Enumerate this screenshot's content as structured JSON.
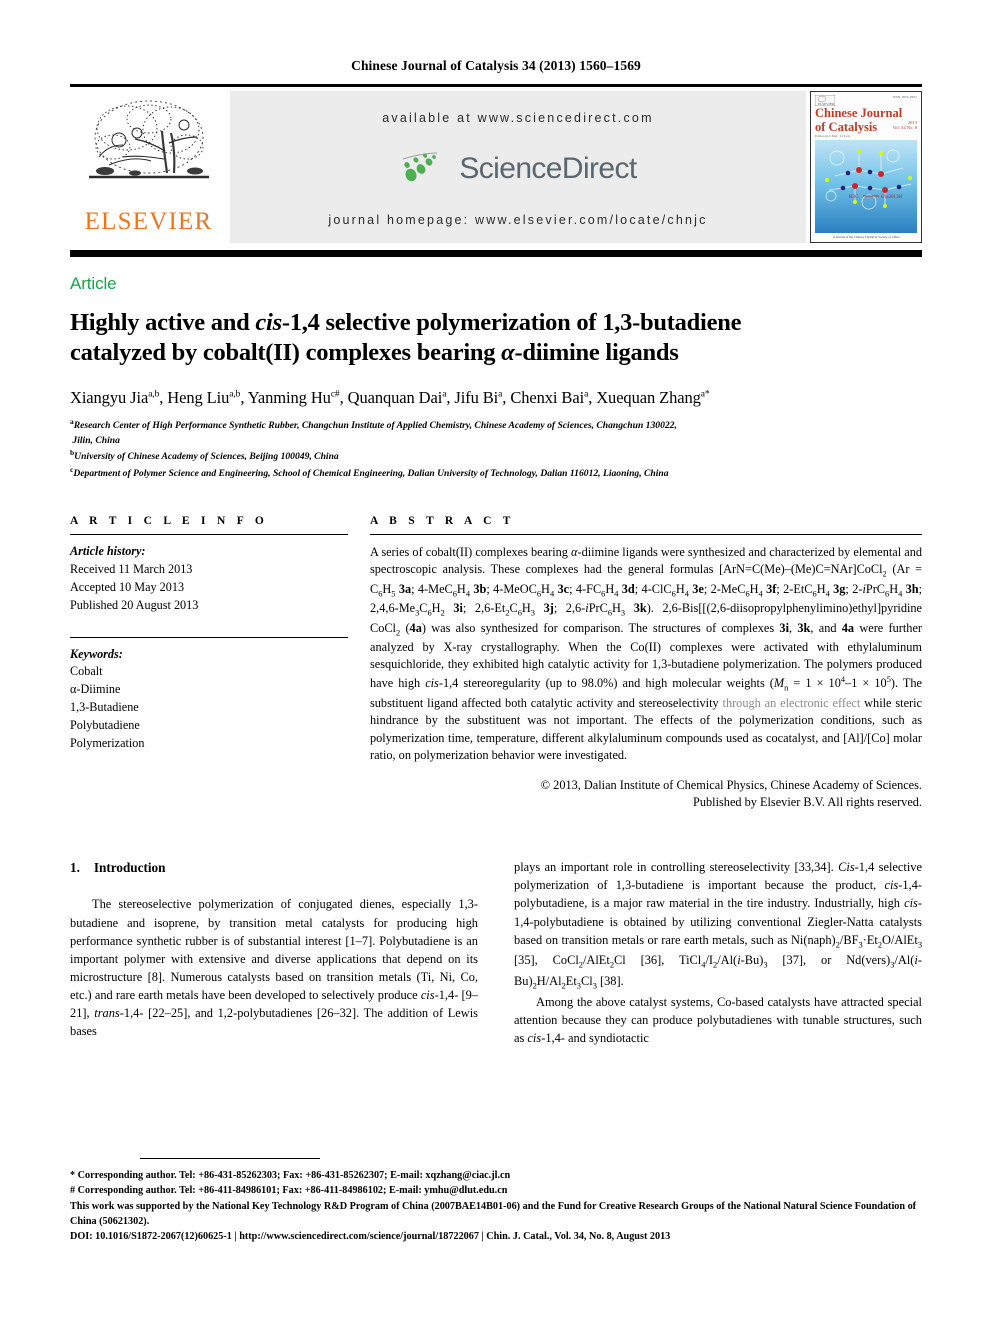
{
  "running_head": "Chinese Journal of Catalysis 34 (2013) 1560–1569",
  "masthead": {
    "publisher_name": "ELSEVIER",
    "available_at": "available at www.sciencedirect.com",
    "sciencedirect_logo_text": "ScienceDirect",
    "journal_homepage": "journal homepage: www.elsevier.com/locate/chnjc",
    "cover": {
      "title_line1": "Chinese Journal",
      "title_line2": "of Catalysis",
      "issn": "ISSN 1872-2067",
      "editor_line": "Editor-in-Chief: Li Can",
      "year": "2013",
      "volume": "Vol. 34  No. 8",
      "footer": "A Journal of the Chinese Chemical Society of China"
    }
  },
  "article_type": "Article",
  "title": {
    "line1_pre": "Highly active and ",
    "line1_italic": "cis",
    "line1_post": "-1,4 selective polymerization of 1,3-butadiene",
    "line2_pre": "catalyzed by cobalt(II) complexes bearing ",
    "line2_italic": "α",
    "line2_post": "-diimine ligands"
  },
  "authors": "Xiangyu Jia a,b, Heng Liu a,b, Yanming Hu c#, Quanquan Dai a, Jifu Bi a, Chenxi Bai a, Xuequan Zhang a*",
  "affiliations": [
    "a Research Center of High Performance Synthetic Rubber, Changchun Institute of Applied Chemistry, Chinese Academy of Sciences, Changchun 130022, Jilin, China",
    "b University of Chinese Academy of Sciences, Beijing 100049, China",
    "c Department of Polymer Science and Engineering, School of Chemical Engineering, Dalian University of Technology, Dalian 116012, Liaoning, China"
  ],
  "affiliation_parts": [
    {
      "mark": "a",
      "text": "Research Center of High Performance Synthetic Rubber, Changchun Institute of Applied Chemistry, Chinese Academy of Sciences, Changchun 130022,"
    },
    {
      "mark": "",
      "text": "Jilin, China"
    },
    {
      "mark": "b",
      "text": "University of Chinese Academy of Sciences, Beijing 100049, China"
    },
    {
      "mark": "c",
      "text": "Department of Polymer Science and Engineering, School of Chemical Engineering, Dalian University of Technology, Dalian 116012, Liaoning, China"
    }
  ],
  "article_info": {
    "heading": "A R T I C L E    I N F O",
    "history_label": "Article history:",
    "received": "Received 11 March 2013",
    "accepted": "Accepted 10 May 2013",
    "published": "Published 20 August 2013",
    "keywords_label": "Keywords:",
    "keywords": [
      "Cobalt",
      "α-Diimine",
      "1,3-Butadiene",
      "Polybutadiene",
      "Polymerization"
    ]
  },
  "abstract": {
    "heading": "A B S T R A C T",
    "p1_a": "A series of cobalt(II) complexes bearing ",
    "p1_alpha": "α",
    "p1_b": "-diimine ligands were synthesized and characterized by elemental and spectroscopic analysis. These complexes had the general formulas [ArN=C(Me)–(Me)C=NAr]CoCl",
    "p1_sub2": "2",
    "p1_c": " (Ar = C",
    "formula_run": "(Ar = C6H5 3a; 4-MeC6H4 3b; 4-MeOC6H4 3c; 4-FC6H4 3d; 4-ClC6H4 3e; 2-MeC6H4 3f; 2-EtC6H4 3g; 2-PrC6H4 3h; 2,4,6-Me3C6H2 3i; 2,6-Et2C6H3 3j; 2,6-iPrC6H3 3k).",
    "p2": "2,6-Bis[[(2,6-diisopropylphenylimino)ethyl]pyridine CoCl2 (4a) was also synthesized for comparison. The structures of complexes 3i, 3k, and 4a were further analyzed by X-ray crystallography. When the Co(II) complexes were activated with ethylaluminum sesquichloride, they exhibited high catalytic activity for 1,3-butadiene polymerization. The polymers produced have high cis-1,4 stereoregularity (up to 98.0%) and high molecular weights (Mn = 1 × 104–1 × 105). The substituent ligand affected both catalytic activity and stereoselectivity",
    "gray_phrase": " through an electronic effect ",
    "p3": "while steric hindrance by the substituent was not important. The effects of the polymerization conditions, such as polymerization time, temperature, different alkylaluminum compounds used as cocatalyst, and [Al]/[Co] molar ratio, on polymerization behavior were investigated.",
    "copyright_line1": "© 2013, Dalian Institute of Chemical Physics, Chinese Academy of Sciences.",
    "copyright_line2": "Published by Elsevier B.V. All rights reserved."
  },
  "introduction": {
    "number": "1.",
    "heading": "Introduction",
    "left_p1": "The stereoselective polymerization of conjugated dienes, especially 1,3-butadiene and isoprene, by transition metal catalysts for producing high performance synthetic rubber is of substantial interest [1–7]. Polybutadiene is an important polymer with extensive and diverse applications that depend on its microstructure [8]. Numerous catalysts based on transition metals (Ti, Ni, Co, etc.) and rare earth metals have been developed to selectively produce cis-1,4- [9–21], trans-1,4- [22–25], and 1,2-polybutadienes [26–32]. The addition of Lewis bases",
    "right_p1": "plays an important role in controlling stereoselectivity [33,34]. Cis-1,4 selective polymerization of 1,3-butadiene is important because the product, cis-1,4-polybutadiene, is a major raw material in the tire industry. Industrially, high cis-1,4-polybutadiene is obtained by utilizing conventional Ziegler-Natta catalysts based on transition metals or rare earth metals, such as Ni(naph)2/BF3·Et2O/AlEt3 [35], CoCl2/AlEt2Cl [36], TiCl4/I2/Al(i-Bu)3 [37], or Nd(vers)3/Al(i-Bu)2H/Al2Et3Cl3 [38].",
    "right_p2": "Among the above catalyst systems, Co-based catalysts have attracted special attention because they can produce polybutadienes with tunable structures, such as cis-1,4- and syndiotactic"
  },
  "footnotes": {
    "corr1": "* Corresponding author. Tel: +86-431-85262303; Fax: +86-431-85262307; E-mail: xqzhang@ciac.jl.cn",
    "corr2": "# Corresponding author. Tel: +86-411-84986101; Fax: +86-411-84986102; E-mail: ymhu@dlut.edu.cn",
    "funding": "This work was supported by the National Key Technology R&D Program of China (2007BAE14B01-06) and the Fund for Creative Research Groups of the National Natural Science Foundation of China (50621302).",
    "doi_line": "DOI: 10.1016/S1872-2067(12)60625-1 | http://www.sciencedirect.com/science/journal/18722067 | Chin. J. Catal., Vol. 34, No. 8, August 2013"
  },
  "colors": {
    "elsevier_orange": "#E87722",
    "article_green": "#1FA14B",
    "sciencedirect_gray": "#5b6770",
    "sciencedirect_green": "#4caf50",
    "cover_red": "#c0392b",
    "gray_text": "#8a8a8a"
  }
}
